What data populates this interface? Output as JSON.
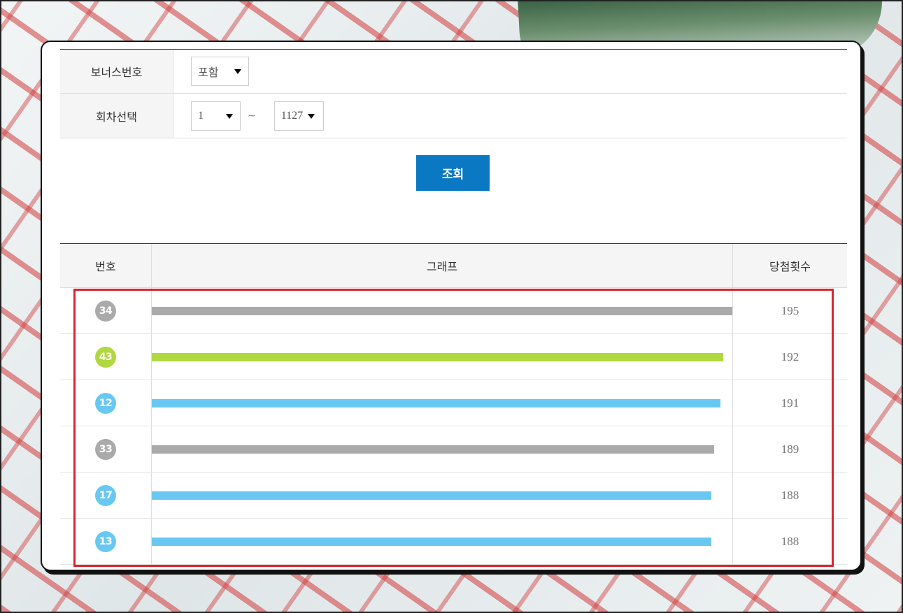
{
  "filter": {
    "bonus_label": "보너스번호",
    "bonus_value": "포함",
    "round_label": "회차선택",
    "round_from": "1",
    "round_tilde": "~",
    "round_to": "1127",
    "search_button": "조회"
  },
  "table": {
    "headers": {
      "number": "번호",
      "graph": "그래프",
      "count": "당첨횟수"
    },
    "max_count": 195,
    "rows": [
      {
        "number": "34",
        "count": "195",
        "color": "#aaaaaa",
        "value": 195
      },
      {
        "number": "43",
        "count": "192",
        "color": "#b0d840",
        "value": 192
      },
      {
        "number": "12",
        "count": "191",
        "color": "#69c8f2",
        "value": 191
      },
      {
        "number": "33",
        "count": "189",
        "color": "#aaaaaa",
        "value": 189
      },
      {
        "number": "17",
        "count": "188",
        "color": "#69c8f2",
        "value": 188
      },
      {
        "number": "13",
        "count": "188",
        "color": "#69c8f2",
        "value": 188
      }
    ]
  },
  "colors": {
    "button": "#0a78c2",
    "highlight": "#d9252f"
  }
}
